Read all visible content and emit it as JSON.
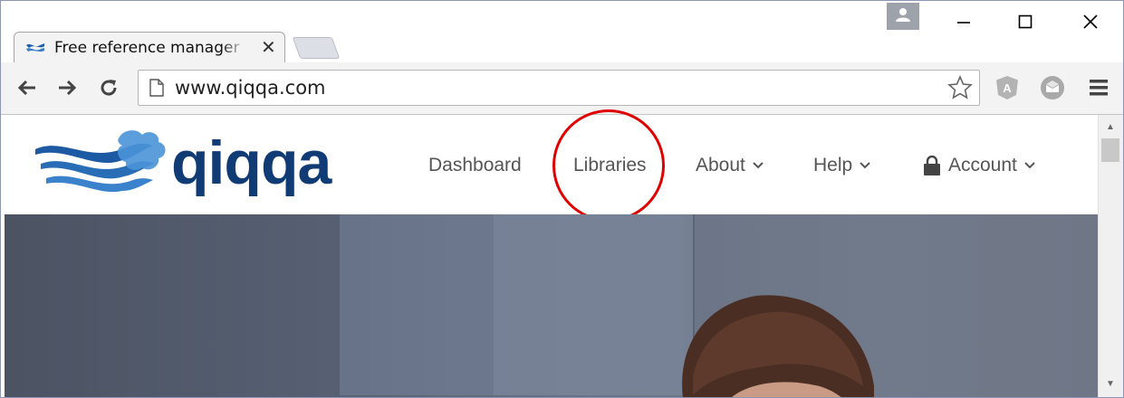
{
  "browser": {
    "tab": {
      "title": "Free reference manager and PDF management",
      "close_label": "✕"
    },
    "address_bar": {
      "url": "www.qiqqa.com"
    }
  },
  "site": {
    "brand": "qiqqa",
    "nav": [
      {
        "label": "Dashboard",
        "has_dropdown": false
      },
      {
        "label": "Libraries",
        "has_dropdown": false
      },
      {
        "label": "About",
        "has_dropdown": true
      },
      {
        "label": "Help",
        "has_dropdown": true
      },
      {
        "label": "Account",
        "has_dropdown": true,
        "icon": "lock-icon"
      }
    ],
    "caret_glyph": "⌄"
  },
  "annotation": {
    "highlighted_item": "Libraries",
    "color": "#e00000"
  },
  "colors": {
    "brand": "#113b75",
    "logo_wave": "#2f6fb3",
    "nav_text": "#555555"
  }
}
